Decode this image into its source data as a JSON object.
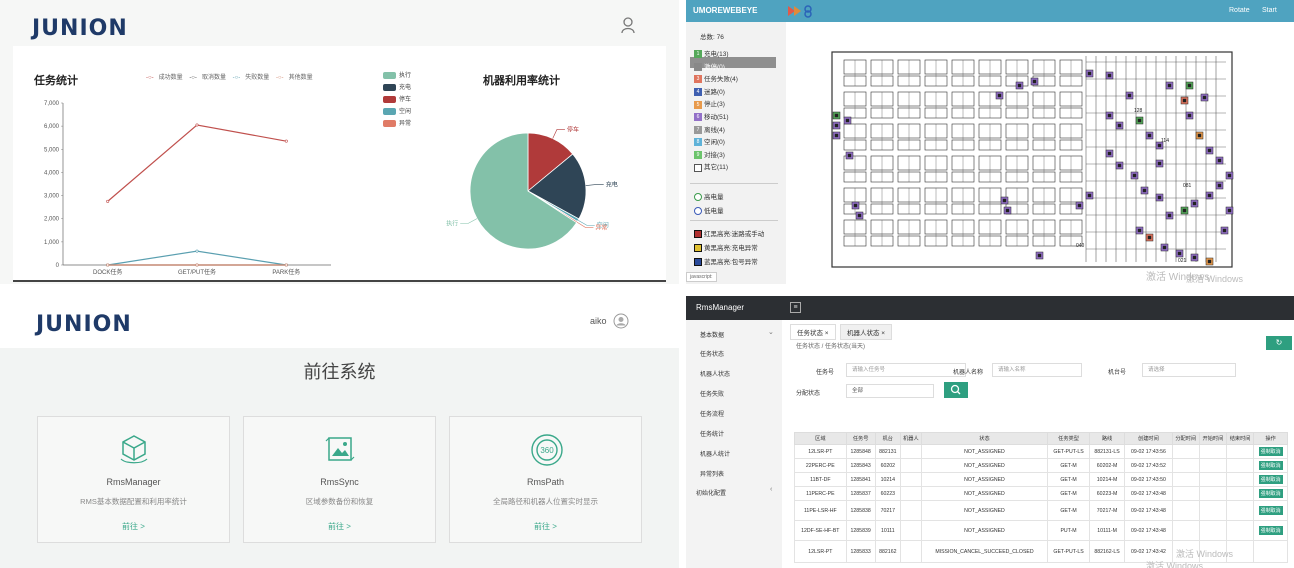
{
  "q1": {
    "logo": "JUNION",
    "task_title": "任务统计",
    "legend": [
      "成功数量",
      "取消数量",
      "失败数量",
      "其他数量"
    ],
    "util_title": "机器利用率统计",
    "status_legend": [
      {
        "label": "执行",
        "color": "#83c1a9"
      },
      {
        "label": "充电",
        "color": "#2f4556"
      },
      {
        "label": "停车",
        "color": "#b03a3a"
      },
      {
        "label": "空闲",
        "color": "#5aa6b2"
      },
      {
        "label": "异常",
        "color": "#e07b66"
      }
    ],
    "pie_labels": {
      "stop": "停车",
      "charge": "充电",
      "exec": "执行",
      "idle": "空闲",
      "err": "异常"
    }
  },
  "chart_data": [
    {
      "type": "line",
      "title": "任务统计",
      "categories": [
        "DOCK任务",
        "GET/PUT任务",
        "PARK任务"
      ],
      "y_ticks": [
        "0",
        "1,000",
        "2,000",
        "3,000",
        "4,000",
        "5,000",
        "6,000",
        "7,000"
      ],
      "ylim": [
        0,
        7000
      ],
      "series": [
        {
          "name": "成功数量",
          "color": "#c0504d",
          "values": [
            2750,
            6050,
            5350
          ]
        },
        {
          "name": "取消数量",
          "color": "#555555",
          "values": [
            0,
            0,
            0
          ]
        },
        {
          "name": "失败数量",
          "color": "#5a9fb0",
          "values": [
            0,
            600,
            0
          ]
        },
        {
          "name": "其他数量",
          "color": "#d28a72",
          "values": [
            0,
            0,
            0
          ]
        }
      ]
    },
    {
      "type": "pie",
      "title": "机器利用率统计",
      "slices": [
        {
          "label": "停车",
          "value": 14,
          "color": "#b03a3a"
        },
        {
          "label": "充电",
          "value": 19,
          "color": "#2f4556"
        },
        {
          "label": "空闲",
          "value": 0.8,
          "color": "#5aa6b2"
        },
        {
          "label": "异常",
          "value": 0.4,
          "color": "#e07b66"
        },
        {
          "label": "执行",
          "value": 65.8,
          "color": "#83c1a9"
        }
      ]
    }
  ],
  "q2": {
    "title": "UMOREWEBEYE",
    "rotate": "Rotate",
    "start": "Start",
    "total": "总数: 76",
    "statuses": [
      {
        "label": "充电(13)",
        "color": "#55a85a",
        "n": "1"
      },
      {
        "label": "激停(0)",
        "color": "#888888",
        "n": "",
        "selected": true
      },
      {
        "label": "任务失败(4)",
        "color": "#e0755e",
        "n": "3"
      },
      {
        "label": "迷路(0)",
        "color": "#3f5fb0",
        "n": "4"
      },
      {
        "label": "停止(3)",
        "color": "#e89a4c",
        "n": "5"
      },
      {
        "label": "移动(51)",
        "color": "#9370c8",
        "n": "6"
      },
      {
        "label": "离线(4)",
        "color": "#999999",
        "n": "7"
      },
      {
        "label": "空闲(0)",
        "color": "#5fb2d8",
        "n": "8"
      },
      {
        "label": "对接(3)",
        "color": "#6cc46c",
        "n": "9"
      },
      {
        "label": "其它(11)",
        "color": "#ffffff",
        "n": ""
      }
    ],
    "battery": [
      "高电量",
      "低电量"
    ],
    "alerts": [
      "红黑高亮:迷路或手动",
      "黄黑高亮:充电异常",
      "蓝黑高亮:包号异常"
    ],
    "footer": "javascript:",
    "watermark": "激活 Windows",
    "watermark2": "激活 Windows",
    "map_labels": [
      "081",
      "114",
      "021",
      "128",
      "040"
    ]
  },
  "q3": {
    "logo": "JUNION",
    "user": "aiko",
    "title": "前往系统",
    "cards": [
      {
        "name": "RmsManager",
        "desc": "RMS基本数据配置和利用率统计",
        "go": "前往 >"
      },
      {
        "name": "RmsSync",
        "desc": "区域参数备份和恢复",
        "go": "前往 >"
      },
      {
        "name": "RmsPath",
        "desc": "全局路径和机器人位置实时显示",
        "go": "前往 >"
      }
    ]
  },
  "q4": {
    "title": "RmsManager",
    "menu": [
      "基本数据",
      "任务状态",
      "机器人状态",
      "任务失败",
      "任务流程",
      "任务统计",
      "机器人统计",
      "异常列表",
      "初始化配置"
    ],
    "tabs": [
      "任务状态",
      "机器人状态"
    ],
    "breadcrumb": "任务状态 / 任务状态(当天)",
    "filters": {
      "task_no": "任务号",
      "task_no_ph": "请输入任务号",
      "robot_name": "机器人名称",
      "robot_name_ph": "请输入名称",
      "rack_no": "机台号",
      "rack_no_ph": "请选择",
      "assign_state": "分配状态",
      "assign_state_val": "全部"
    },
    "columns": [
      "区域",
      "任务号",
      "机台",
      "机器人",
      "状态",
      "任务类型",
      "路线",
      "创建时间",
      "分配时间",
      "开始时间",
      "结束时间",
      "操作"
    ],
    "rows": [
      [
        "12LSR-PT",
        "1285848",
        "882131",
        "",
        "NOT_ASSIGNED",
        "GET-PUT-LS",
        "882131-LS",
        "09-02 17:43:56",
        "",
        "",
        "",
        "强制取消"
      ],
      [
        "22PERC-PE",
        "1285843",
        "60202",
        "",
        "NOT_ASSIGNED",
        "GET-M",
        "60202-M",
        "09-02 17:43:52",
        "",
        "",
        "",
        "强制取消"
      ],
      [
        "11BT-DF",
        "1285841",
        "10214",
        "",
        "NOT_ASSIGNED",
        "GET-M",
        "10214-M",
        "09-02 17:43:50",
        "",
        "",
        "",
        "强制取消"
      ],
      [
        "11PERC-PE",
        "1285837",
        "60223",
        "",
        "NOT_ASSIGNED",
        "GET-M",
        "60223-M",
        "09-02 17:43:48",
        "",
        "",
        "",
        "强制取消"
      ],
      [
        "11PE-LSR-HF",
        "1285838",
        "70217",
        "",
        "NOT_ASSIGNED",
        "GET-M",
        "70217-M",
        "09-02 17:43:48",
        "",
        "",
        "",
        "强制取消"
      ],
      [
        "12DF-SE-HF-BT",
        "1285839",
        "10111",
        "",
        "NOT_ASSIGNED",
        "PUT-M",
        "10111-M",
        "09-02 17:43:48",
        "",
        "",
        "",
        "强制取消"
      ],
      [
        "12LSR-PT",
        "1285833",
        "882162",
        "",
        "MISSION_CANCEL_SUCCEED_CLOSED",
        "GET-PUT-LS",
        "882162-LS",
        "09-02 17:43:42",
        "",
        "",
        "",
        ""
      ]
    ],
    "watermark": "激活 Windows",
    "watermark2": "激活 Windows"
  }
}
